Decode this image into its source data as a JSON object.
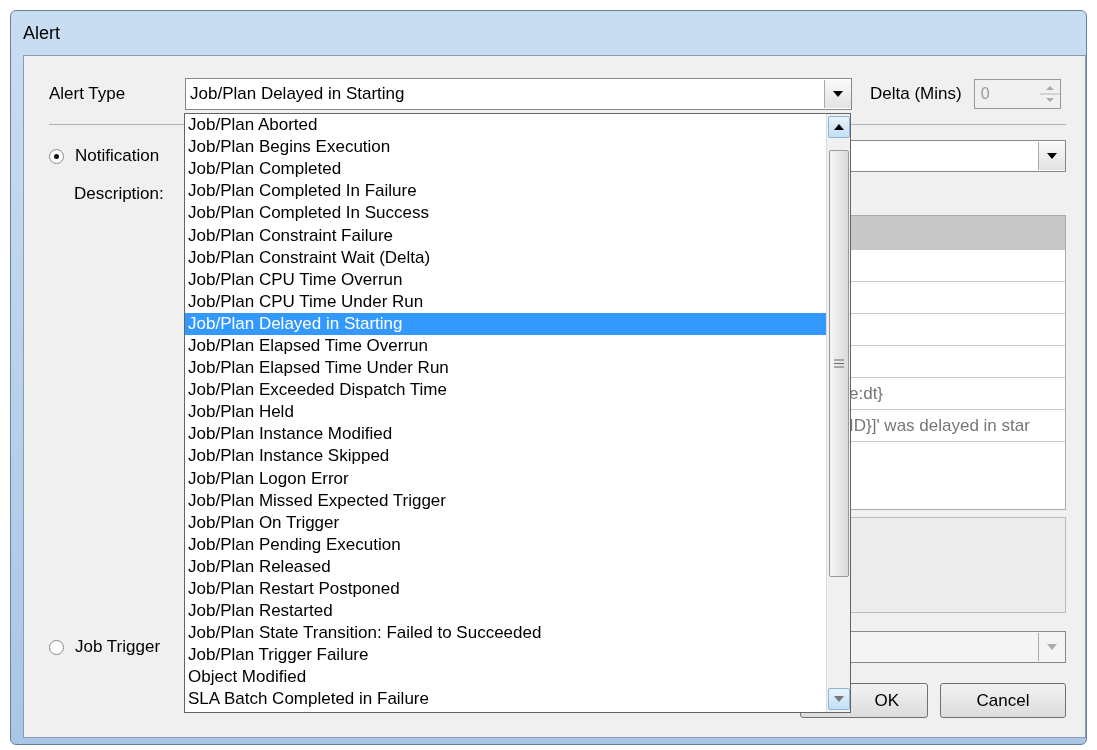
{
  "window": {
    "title": "Alert"
  },
  "alert_type": {
    "label": "Alert Type",
    "value": "Job/Plan Delayed in Starting",
    "expanded": true
  },
  "delta": {
    "label": "Delta (Mins)",
    "value": "0",
    "disabled": true
  },
  "options": [
    {
      "label": "Job/Plan Aborted",
      "selected": false
    },
    {
      "label": "Job/Plan Begins Execution",
      "selected": false
    },
    {
      "label": "Job/Plan Completed",
      "selected": false
    },
    {
      "label": "Job/Plan Completed In Failure",
      "selected": false
    },
    {
      "label": "Job/Plan Completed In Success",
      "selected": false
    },
    {
      "label": "Job/Plan Constraint Failure",
      "selected": false
    },
    {
      "label": "Job/Plan Constraint Wait (Delta)",
      "selected": false
    },
    {
      "label": "Job/Plan CPU Time Overrun",
      "selected": false
    },
    {
      "label": "Job/Plan CPU Time Under Run",
      "selected": false
    },
    {
      "label": "Job/Plan Delayed in Starting",
      "selected": true
    },
    {
      "label": "Job/Plan Elapsed Time Overrun",
      "selected": false
    },
    {
      "label": "Job/Plan Elapsed Time Under Run",
      "selected": false
    },
    {
      "label": "Job/Plan Exceeded Dispatch Time",
      "selected": false
    },
    {
      "label": "Job/Plan Held",
      "selected": false
    },
    {
      "label": "Job/Plan Instance Modified",
      "selected": false
    },
    {
      "label": "Job/Plan Instance Skipped",
      "selected": false
    },
    {
      "label": "Job/Plan Logon Error",
      "selected": false
    },
    {
      "label": "Job/Plan Missed Expected Trigger",
      "selected": false
    },
    {
      "label": "Job/Plan On Trigger",
      "selected": false
    },
    {
      "label": "Job/Plan Pending Execution",
      "selected": false
    },
    {
      "label": "Job/Plan Released",
      "selected": false
    },
    {
      "label": "Job/Plan Restart Postponed",
      "selected": false
    },
    {
      "label": "Job/Plan Restarted",
      "selected": false
    },
    {
      "label": "Job/Plan State Transition: Failed to Succeeded",
      "selected": false
    },
    {
      "label": "Job/Plan Trigger Failure",
      "selected": false
    },
    {
      "label": "Object Modified",
      "selected": false
    },
    {
      "label": "SLA Batch Completed in Failure",
      "selected": false
    }
  ],
  "modes": [
    {
      "label": "Notification",
      "selected": true
    },
    {
      "label": "Job Trigger",
      "selected": false
    }
  ],
  "description_label": "Description:",
  "grid_text": [
    "e:dt}",
    "ID}]' was delayed in star"
  ],
  "trigger_combo": {
    "disabled": true
  },
  "buttons": [
    {
      "label": "OK"
    },
    {
      "label": "Cancel"
    }
  ]
}
